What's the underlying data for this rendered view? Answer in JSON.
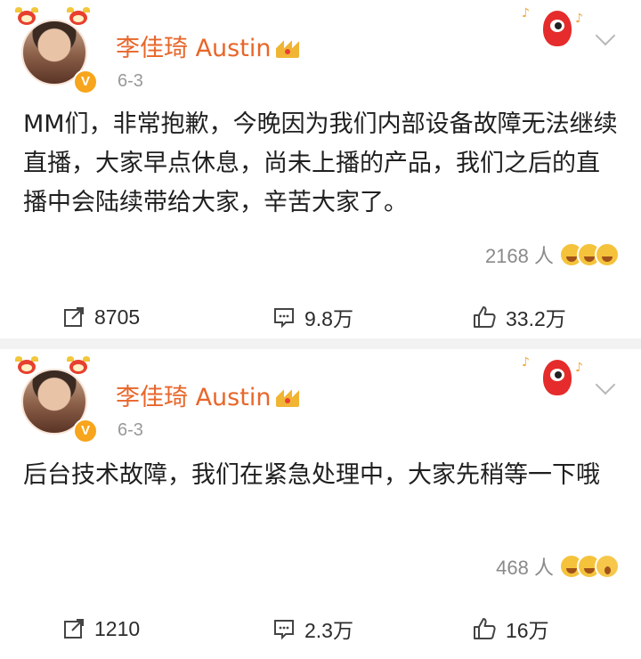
{
  "posts": [
    {
      "author": "李佳琦 Austin",
      "verified_badge": "V",
      "date": "6-3",
      "text": "MM们，非常抱歉，今晚因为我们内部设备故障无法继续直播，大家早点休息，尚未上播的产品，我们之后的直播中会陆续带给大家，辛苦大家了。",
      "reaction_count": "2168 人",
      "reaction_icons": [
        "grin-emoji",
        "laugh-emoji",
        "laugh-emoji"
      ],
      "reposts": "8705",
      "comments": "9.8万",
      "likes": "33.2万"
    },
    {
      "author": "李佳琦 Austin",
      "verified_badge": "V",
      "date": "6-3",
      "text": "后台技术故障，我们在紧急处理中，大家先稍等一下哦",
      "reaction_count": "468 人",
      "reaction_icons": [
        "grin-emoji",
        "laugh-emoji",
        "surprised-emoji"
      ],
      "reposts": "1210",
      "comments": "2.3万",
      "likes": "16万"
    }
  ],
  "colors": {
    "name": "#e8662a",
    "meta": "#999999",
    "divider": "#f2f2f2",
    "badge": "#f7a51c"
  },
  "icons": {
    "repost": "repost-icon",
    "comment": "comment-icon",
    "like": "thumbs-up-icon",
    "crown": "crown-icon",
    "more": "chevron-down-icon",
    "mascot": "mascot-icon"
  }
}
